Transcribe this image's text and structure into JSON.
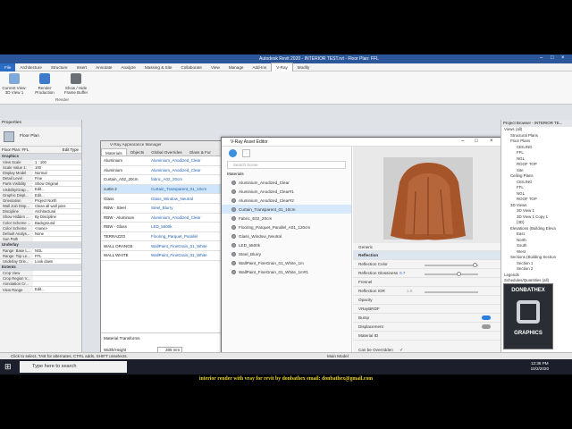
{
  "app": {
    "title": "Autodesk Revit 2020 - INTERIOR TEST.rvt - Floor Plan: FFL",
    "ribbon_tabs": [
      "File",
      "Architecture",
      "Structure",
      "Insert",
      "Annotate",
      "Analyze",
      "Massing & Site",
      "Collaborate",
      "View",
      "Manage",
      "Add-Ins",
      "V-Ray",
      "Modify"
    ],
    "ribbon_buttons": [
      "Current View: 3D View 1",
      "Render Production",
      "Show / Hide Frame Buffer"
    ],
    "ribbon_group": "Render"
  },
  "properties": {
    "title": "Properties",
    "type": "Floor Plan",
    "selector": "Floor Plan: FFL",
    "edit_type": "Edit Type",
    "graphics_section": "Graphics",
    "rows": [
      {
        "k": "View Scale",
        "v": "1 : 100"
      },
      {
        "k": "Scale Value 1:",
        "v": "100"
      },
      {
        "k": "Display Model",
        "v": "Normal"
      },
      {
        "k": "Detail Level",
        "v": "Fine"
      },
      {
        "k": "Parts Visibility",
        "v": "Show Original"
      },
      {
        "k": "Visibility/Grap...",
        "v": "Edit..."
      },
      {
        "k": "Graphic Displ...",
        "v": "Edit..."
      },
      {
        "k": "Orientation",
        "v": "Project North"
      },
      {
        "k": "Wall Join Disp...",
        "v": "Clean all wall joins"
      },
      {
        "k": "Discipline",
        "v": "Architectural"
      },
      {
        "k": "Show Hidden ...",
        "v": "By Discipline"
      },
      {
        "k": "Color Scheme ...",
        "v": "Background"
      },
      {
        "k": "Color Scheme",
        "v": "<none>"
      },
      {
        "k": "Default Analys...",
        "v": "None"
      },
      {
        "k": "Sun Path",
        "v": ""
      }
    ],
    "underlay_section": "Underlay",
    "underlay_rows": [
      {
        "k": "Range: Base L...",
        "v": "NGL"
      },
      {
        "k": "Range: Top Le...",
        "v": "FFL"
      },
      {
        "k": "Underlay Orie...",
        "v": "Look down"
      }
    ],
    "extents_section": "Extents",
    "extents_rows": [
      {
        "k": "Crop View",
        "v": ""
      },
      {
        "k": "Crop Region V...",
        "v": ""
      },
      {
        "k": "Annotation Cr...",
        "v": ""
      },
      {
        "k": "View Range",
        "v": "Edit..."
      }
    ],
    "help": "Properties help",
    "apply": "Apply"
  },
  "appearance_manager": {
    "title": "V-Ray Appearance Manager",
    "tabs": [
      "Materials",
      "Objects",
      "Global Overrides",
      "Glass & Fur"
    ],
    "rows": [
      {
        "n": "Aluminium",
        "m": "Aluminium_Anodized_Clear"
      },
      {
        "n": "Aluminium",
        "m": "Aluminium_Anodized_Clear"
      },
      {
        "n": "Curtain_A02_20cm",
        "m": "fabric_A02_20cm"
      },
      {
        "n": "curtin 2",
        "m": "Curtain_Transparent_01_10cm"
      },
      {
        "n": "Glass",
        "m": "Glass_Window_Neutral"
      },
      {
        "n": "RBW - Steel",
        "m": "Steel_Blurry"
      },
      {
        "n": "RBW - Aluminum",
        "m": "Aluminium_Anodized_Clear"
      },
      {
        "n": "RBW - Glass",
        "m": "LED_5500k"
      },
      {
        "n": "TERRAZZO",
        "m": "Flooring_Parquet_Parallel"
      },
      {
        "n": "WALL ORANGE",
        "m": "WallPaint_FineGrain_01_White"
      },
      {
        "n": "WALL WHITE",
        "m": "WallPaint_FineGrain_01_White"
      }
    ],
    "transforms_title": "Material Transforms",
    "width_height": "Width/Height",
    "wh_value": "305 mm",
    "rotation": "Rotation",
    "offset": "Offset X/Y",
    "offset_value": "0 mm"
  },
  "vray_editor": {
    "title": "V-Ray Asset Editor",
    "search_placeholder": "Search Scene",
    "materials_header": "Materials",
    "materials": [
      "Aluminium_Anodized_Clear",
      "Aluminium_Anodized_Clear#1",
      "Aluminium_Anodized_Clear#2",
      "Curtain_Transparent_01_10cm",
      "Fabric_E02_20cm",
      "Flooring_Parquet_Parallel_A01_120cm",
      "Glass_Window_Neutral",
      "LED_5500k",
      "Steel_Blurry",
      "WallPaint_FineGrain_01_White_1m",
      "WallPaint_FineGrain_01_White_1m#1"
    ],
    "selected_index": 3,
    "generic_label": "Generic",
    "reflection": "Reflection",
    "reflection_color": "Reflection Color",
    "reflection_glossiness": "Reflection Glossiness",
    "glossiness_value": "0.7",
    "fresnel": "Fresnel",
    "reflection_ior": "Reflection IOR",
    "ior_value": "1.6",
    "opacity": "Opacity",
    "vraybrdf": "VRayBRDF",
    "bump": "Bump",
    "displacement": "Displacement",
    "material_id": "Material ID",
    "can_be_overridden": "Can be Overridden"
  },
  "project_browser": {
    "title": "Project Browser - INTERIOR TE...",
    "items": [
      {
        "t": "Views (all)",
        "lvl": 0
      },
      {
        "t": "Structural Plans",
        "lvl": 1
      },
      {
        "t": "Floor Plans",
        "lvl": 1
      },
      {
        "t": "CEILING",
        "lvl": 2
      },
      {
        "t": "FFL",
        "lvl": 2
      },
      {
        "t": "NGL",
        "lvl": 2
      },
      {
        "t": "ROOF TOP",
        "lvl": 2
      },
      {
        "t": "Site",
        "lvl": 2
      },
      {
        "t": "Ceiling Plans",
        "lvl": 1
      },
      {
        "t": "CEILING",
        "lvl": 2
      },
      {
        "t": "FFL",
        "lvl": 2
      },
      {
        "t": "NGL",
        "lvl": 2
      },
      {
        "t": "ROOF TOP",
        "lvl": 2
      },
      {
        "t": "3D Views",
        "lvl": 1
      },
      {
        "t": "3D View 1",
        "lvl": 2
      },
      {
        "t": "3D View 1 Copy 1",
        "lvl": 2
      },
      {
        "t": "{3D}",
        "lvl": 2
      },
      {
        "t": "Elevations (Building Eleva",
        "lvl": 1
      },
      {
        "t": "East",
        "lvl": 2
      },
      {
        "t": "North",
        "lvl": 2
      },
      {
        "t": "South",
        "lvl": 2
      },
      {
        "t": "West",
        "lvl": 2
      },
      {
        "t": "Sections (Building Section",
        "lvl": 1
      },
      {
        "t": "Section 1",
        "lvl": 2
      },
      {
        "t": "Section 2",
        "lvl": 2
      },
      {
        "t": "Legends",
        "lvl": 0
      },
      {
        "t": "Schedules/Quantities (all)",
        "lvl": 0
      },
      {
        "t": "Sheets (all)",
        "lvl": 0
      },
      {
        "t": "Families",
        "lvl": 0
      }
    ]
  },
  "statusbar": {
    "text": "Click to select, TAB for alternates, CTRL adds, SHIFT unselects.",
    "model": "Main Model"
  },
  "taskbar": {
    "search": "Type here to search",
    "time": "12:36 PM",
    "date": "10/2/2020"
  },
  "logo": {
    "line1": "DONBATHEX",
    "line2": "GRAPHICS"
  },
  "caption": "interior render with vray for revit by donbathex    email: donbathex@gmail.com",
  "colors": {
    "accent": "#2b579a",
    "link": "#1f5fb0",
    "selection": "#d6e8fb",
    "caption": "#e9d22b"
  }
}
